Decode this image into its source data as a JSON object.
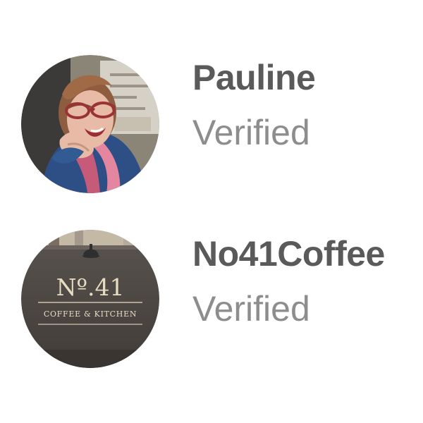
{
  "profiles": [
    {
      "name": "Pauline",
      "status": "Verified",
      "avatar": {
        "icon": "person-photo-avatar",
        "colors": {
          "background": "#8b8577",
          "skin": "#e8bba6",
          "hair": "#8e5d3f",
          "shirt": "#2e4f85",
          "scarf": "#c65b79"
        }
      }
    },
    {
      "name": "No41Coffee",
      "status": "Verified",
      "avatar": {
        "icon": "storefront-sign-avatar",
        "sign_number": "Nº.41",
        "sign_subtitle": "COFFEE & KITCHEN",
        "colors": {
          "sign": "#4f4945",
          "sign_text": "#e6dcc2",
          "lamp": "#2f2f2f"
        }
      }
    }
  ]
}
